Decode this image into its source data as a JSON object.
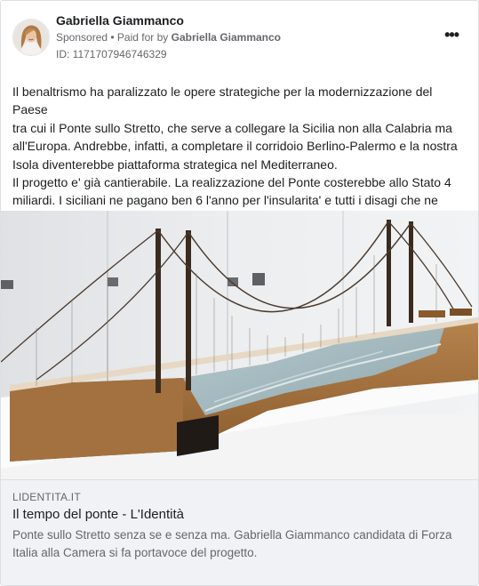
{
  "post": {
    "author": "Gabriella Giammanco",
    "sponsored_label": "Sponsored",
    "separator": " • ",
    "paid_for_prefix": "Paid for by ",
    "paid_for_name": "Gabriella Giammanco",
    "ad_id": "ID: 1171707946746329",
    "more_label": "•••",
    "avatar_icon": "profile-photo-icon",
    "text": "Il benaltrismo ha paralizzato le opere strategiche per la modernizzazione del Paese\ntra cui il Ponte sullo Stretto, che serve a collegare la Sicilia non alla Calabria ma\nall'Europa. Andrebbe, infatti, a completare il corridoio Berlino-Palermo e la nostra\nIsola diventerebbe piattaforma strategica nel Mediterraneo.\nIl progetto e' già cantierabile. La realizzazione del Ponte costerebbe allo Stato 4\nmiliardi. I siciliani ne pagano ben 6 l'anno per l'insularita' e tutti i disagi che ne\nconseguono. Di questo ho parlato col quotidiano Identità, se volete leggere…"
  },
  "link_preview": {
    "domain": "LIDENTITA.IT",
    "title": "Il tempo del ponte - L'Identità",
    "description": "Ponte sullo Stretto senza se e senza ma. Gabriella Giammanco candidata di Forza Italia alla Camera si fa portavoce del progetto.",
    "image_icon": "bridge-model-photo"
  },
  "colors": {
    "text_primary": "#1c1e21",
    "text_secondary": "#65676b",
    "link_background": "#f0f2f5",
    "border": "#dddfe2"
  }
}
